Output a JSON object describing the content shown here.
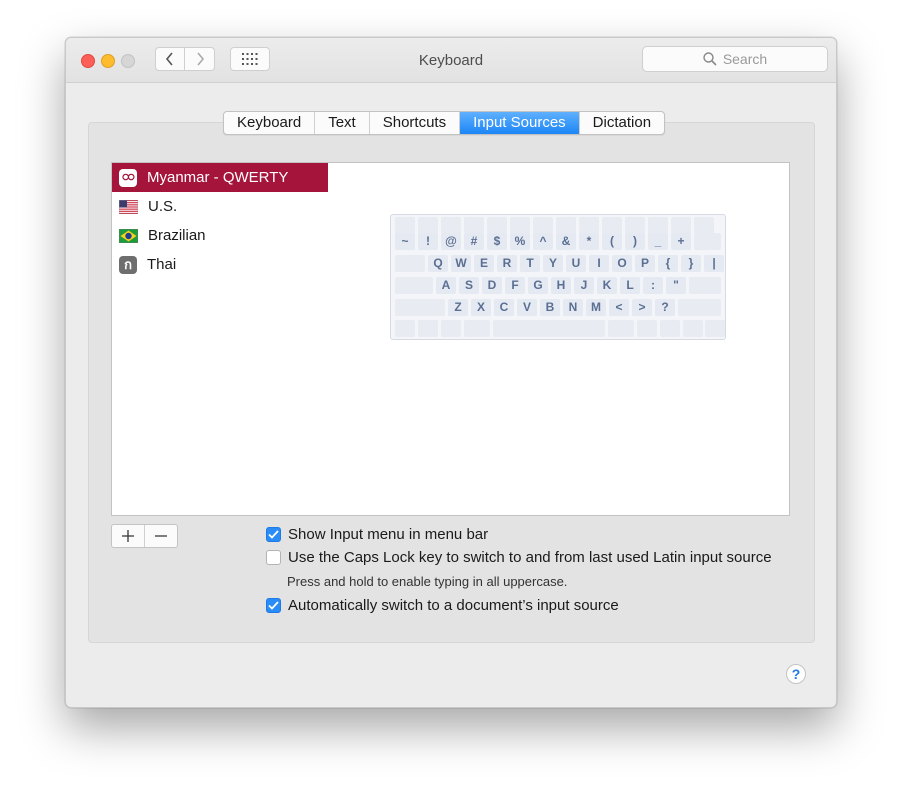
{
  "window": {
    "title": "Keyboard"
  },
  "search": {
    "placeholder": "Search"
  },
  "tabs": [
    {
      "label": "Keyboard",
      "selected": false
    },
    {
      "label": "Text",
      "selected": false
    },
    {
      "label": "Shortcuts",
      "selected": false
    },
    {
      "label": "Input Sources",
      "selected": true
    },
    {
      "label": "Dictation",
      "selected": false
    }
  ],
  "input_sources": [
    {
      "label": "Myanmar - QWERTY",
      "icon": "myanmar-script-icon",
      "icon_glyph": "ထ",
      "selected": true
    },
    {
      "label": "U.S.",
      "icon": "us-flag-icon",
      "selected": false
    },
    {
      "label": "Brazilian",
      "icon": "brazil-flag-icon",
      "selected": false
    },
    {
      "label": "Thai",
      "icon": "thai-script-icon",
      "icon_glyph": "ก",
      "selected": false
    }
  ],
  "keyboard_preview": {
    "row1": [
      "~",
      "!",
      "@",
      "#",
      "$",
      "%",
      "^",
      "&",
      "*",
      "(",
      ")",
      "_",
      "+"
    ],
    "row2": [
      "Q",
      "W",
      "E",
      "R",
      "T",
      "Y",
      "U",
      "I",
      "O",
      "P",
      "{",
      "}",
      "|"
    ],
    "row3": [
      "A",
      "S",
      "D",
      "F",
      "G",
      "H",
      "J",
      "K",
      "L",
      ":",
      "\""
    ],
    "row4": [
      "Z",
      "X",
      "C",
      "V",
      "B",
      "N",
      "M",
      "<",
      ">",
      "?"
    ]
  },
  "list_controls": {
    "add": "+",
    "remove": "−"
  },
  "options": {
    "show_input_menu": {
      "label": "Show Input menu in menu bar",
      "checked": true
    },
    "caps_lock_switch": {
      "label": "Use the Caps Lock key to switch to and from last used Latin input source",
      "checked": false,
      "note": "Press and hold to enable typing in all uppercase."
    },
    "auto_switch": {
      "label": "Automatically switch to a document’s input source",
      "checked": true
    }
  },
  "help": {
    "label": "?"
  },
  "colors": {
    "accent": "#2a8cf7",
    "selection": "#a5143a"
  }
}
